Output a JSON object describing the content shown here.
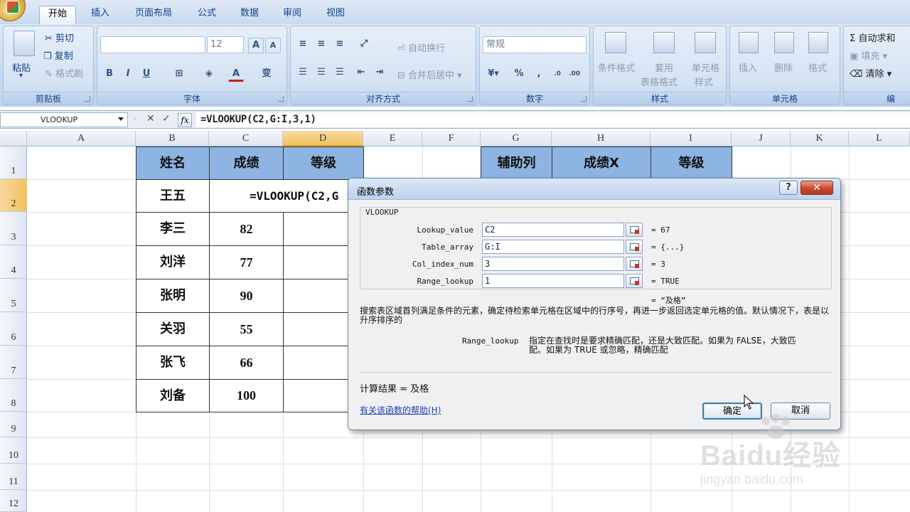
{
  "ribbon_tabs": [
    "开始",
    "插入",
    "页面布局",
    "公式",
    "数据",
    "审阅",
    "视图"
  ],
  "clipboard": {
    "paste": "粘贴",
    "cut": "剪切",
    "copy": "复制",
    "format_painter": "格式刷",
    "label": "剪贴板"
  },
  "font": {
    "size": "12",
    "label": "字体",
    "bold": "B",
    "italic": "I",
    "underline": "U",
    "grow": "A",
    "shrink": "A",
    "color_char": "A",
    "phonetic": "变"
  },
  "alignment": {
    "wrap": "自动换行",
    "merge": "合并后居中",
    "label": "对齐方式"
  },
  "number": {
    "format": "常规",
    "percent": "%",
    "comma": ",",
    "label": "数字"
  },
  "styles": {
    "conditional": "条件格式",
    "table_format_1": "套用",
    "table_format_2": "表格格式",
    "cell_style_1": "单元格",
    "cell_style_2": "样式",
    "label": "样式"
  },
  "cells": {
    "insert": "插入",
    "delete": "删除",
    "format": "格式",
    "label": "单元格"
  },
  "editing": {
    "autosum": "Σ 自动求和",
    "fill": "填充",
    "clear": "清除",
    "label_partial": "编"
  },
  "formula_bar": {
    "name_box": "VLOOKUP",
    "cancel": "✕",
    "enter": "✓",
    "fx": "fx",
    "formula": "=VLOOKUP(C2,G:I,3,1)"
  },
  "columns": [
    "A",
    "B",
    "C",
    "D",
    "E",
    "F",
    "G",
    "H",
    "I",
    "J",
    "K",
    "L"
  ],
  "rows": [
    "1",
    "2",
    "3",
    "4",
    "5",
    "6",
    "7",
    "8",
    "9",
    "10",
    "11",
    "12"
  ],
  "table1": {
    "headers": [
      "姓名",
      "成绩",
      "等级"
    ],
    "rows": [
      {
        "name": "王五",
        "score": "=VLOOKUP(C2,G"
      },
      {
        "name": "李三",
        "score": "82"
      },
      {
        "name": "刘洋",
        "score": "77"
      },
      {
        "name": "张明",
        "score": "90"
      },
      {
        "name": "关羽",
        "score": "55"
      },
      {
        "name": "张飞",
        "score": "66"
      },
      {
        "name": "刘备",
        "score": "100"
      }
    ]
  },
  "table2": {
    "headers": [
      "辅助列",
      "成绩X",
      "等级"
    ]
  },
  "dialog": {
    "title": "函数参数",
    "help_btn": "?",
    "close_btn": "✕",
    "function": "VLOOKUP",
    "params": [
      {
        "label": "Lookup_value",
        "value": "C2",
        "result": "= 67"
      },
      {
        "label": "Table_array",
        "value": "G:I",
        "result": "= {...}"
      },
      {
        "label": "Col_index_num",
        "value": "3",
        "result": "= 3"
      },
      {
        "label": "Range_lookup",
        "value": "1",
        "result": "= TRUE"
      }
    ],
    "overall_result": "= “及格”",
    "description": "搜索表区域首列满足条件的元素，确定待检索单元格在区域中的行序号，再进一步返回选定单元格的值。默认情况下，表是以升序排序的",
    "param_name": "Range_lookup",
    "param_desc_1": "指定在查找时是要求精确匹配，还是大致匹配。如果为 FALSE，大致匹",
    "param_desc_2": "配。如果为 TRUE 或忽略，精确匹配",
    "calc_result": "计算结果 =  及格",
    "help_link": "有关该函数的帮助(H)",
    "ok": "确定",
    "cancel": "取消"
  },
  "watermark": {
    "brand": "Baidu经验",
    "url": "jingyan.baidu.com"
  }
}
